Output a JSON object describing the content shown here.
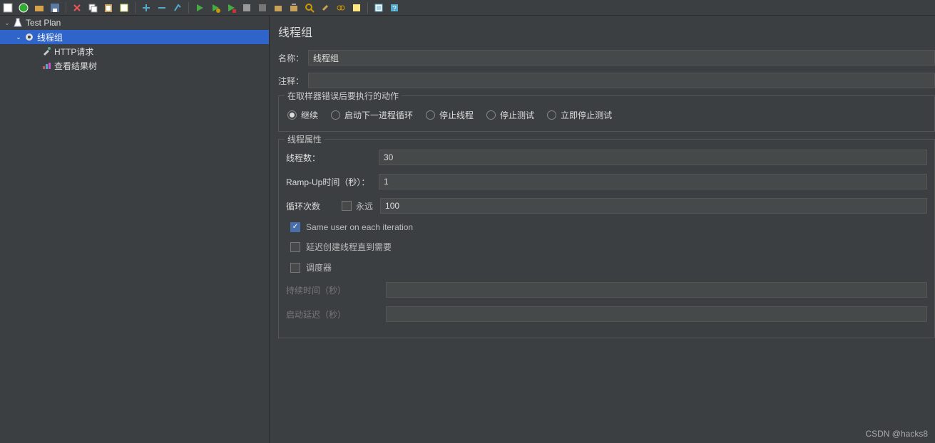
{
  "toolbar": {
    "icons": [
      "file",
      "template",
      "open",
      "save",
      "scissors",
      "copy",
      "paste",
      "note",
      "plus",
      "minus",
      "wand",
      "flag-green",
      "flag-play",
      "flag-stop",
      "stop",
      "stop-all",
      "box",
      "search",
      "broom",
      "rings",
      "gavel",
      "help",
      "question"
    ]
  },
  "tree": {
    "root": {
      "label": "Test Plan",
      "icon": "beaker"
    },
    "thread_group": {
      "label": "线程组",
      "icon": "gear"
    },
    "http_request": {
      "label": "HTTP请求",
      "icon": "dropper"
    },
    "result_tree": {
      "label": "查看结果树",
      "icon": "chart"
    }
  },
  "panel": {
    "title": "线程组",
    "name_label": "名称：",
    "name_value": "线程组",
    "comment_label": "注释：",
    "comment_value": ""
  },
  "error_action": {
    "legend": "在取样器错误后要执行的动作",
    "continue": "继续",
    "start_next": "启动下一进程循环",
    "stop_thread": "停止线程",
    "stop_test": "停止测试",
    "stop_test_now": "立即停止测试"
  },
  "thread_props": {
    "legend": "线程属性",
    "threads_label": "线程数：",
    "threads_value": "30",
    "ramp_label": "Ramp-Up时间（秒）：",
    "ramp_value": "1",
    "loop_label": "循环次数",
    "forever_label": "永远",
    "loop_value": "100",
    "same_user_label": "Same user on each iteration",
    "delay_create_label": "延迟创建线程直到需要",
    "scheduler_label": "调度器"
  },
  "scheduler": {
    "duration_label": "持续时间（秒）",
    "duration_value": "",
    "delay_label": "启动延迟（秒）",
    "delay_value": ""
  },
  "watermark": "CSDN @hacks8"
}
